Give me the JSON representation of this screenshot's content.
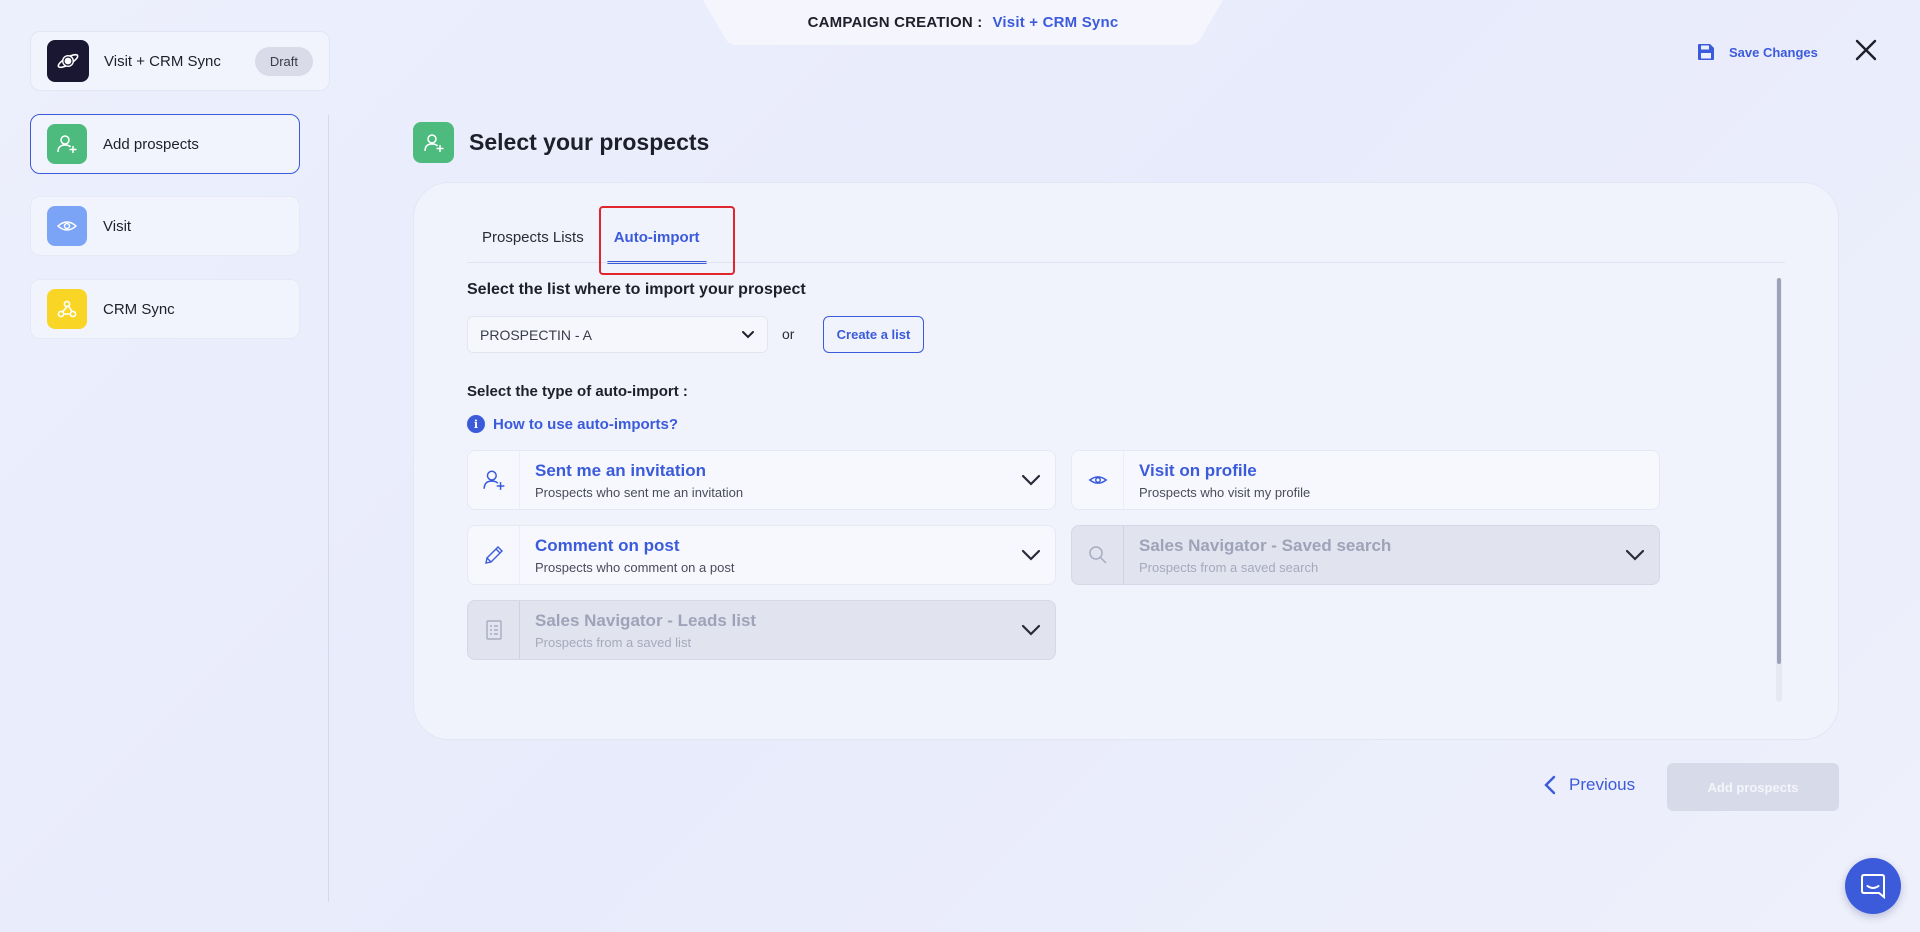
{
  "header": {
    "label": "CAMPAIGN CREATION :",
    "campaign_name": "Visit + CRM Sync",
    "save_label": "Save Changes"
  },
  "sidebar": {
    "campaign": {
      "name": "Visit + CRM Sync",
      "status": "Draft"
    },
    "steps": [
      {
        "label": "Add prospects",
        "icon": "add-user-icon",
        "color": "#4dbb7e",
        "active": true
      },
      {
        "label": "Visit",
        "icon": "eye-icon",
        "color": "#7ba4f7",
        "active": false
      },
      {
        "label": "CRM Sync",
        "icon": "webhook-icon",
        "color": "#f9d626",
        "active": false
      }
    ]
  },
  "main": {
    "title": "Select your prospects",
    "tabs": [
      {
        "label": "Prospects Lists",
        "active": false
      },
      {
        "label": "Auto-import",
        "active": true
      }
    ],
    "list_prompt": "Select the list where to import your prospect",
    "list_select": {
      "value": "PROSPECTIN - A"
    },
    "or_text": "or",
    "create_list_label": "Create a list",
    "type_prompt": "Select the type of auto-import :",
    "help_link": "How to use auto-imports?",
    "cards": [
      {
        "title": "Sent me an invitation",
        "subtitle": "Prospects who sent me an invitation",
        "icon": "add-user-icon",
        "disabled": false,
        "chevron": true
      },
      {
        "title": "Visit on profile",
        "subtitle": "Prospects who visit my profile",
        "icon": "eye-icon",
        "disabled": false,
        "chevron": false
      },
      {
        "title": "Comment on post",
        "subtitle": "Prospects who comment on a post",
        "icon": "pencil-icon",
        "disabled": false,
        "chevron": true
      },
      {
        "title": "Sales Navigator - Saved search",
        "subtitle": "Prospects from a saved search",
        "icon": "search-icon",
        "disabled": true,
        "chevron": true
      },
      {
        "title": "Sales Navigator - Leads list",
        "subtitle": "Prospects from a saved list",
        "icon": "list-icon",
        "disabled": true,
        "chevron": true
      }
    ]
  },
  "footer": {
    "previous_label": "Previous",
    "add_label": "Add prospects"
  },
  "colors": {
    "accent": "#3b5bdb",
    "highlight": "#e0262c"
  }
}
